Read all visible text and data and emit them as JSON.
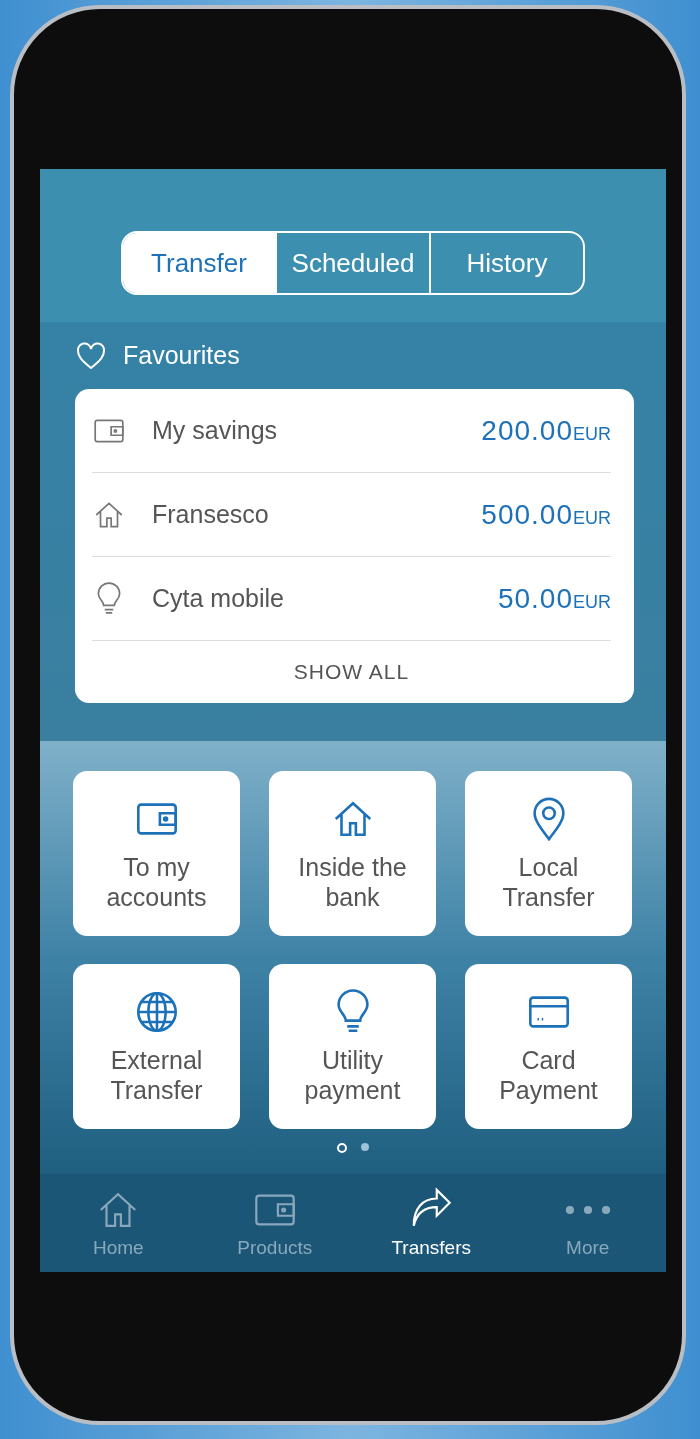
{
  "tabs": [
    {
      "label": "Transfer",
      "selected": true
    },
    {
      "label": "Scheduled",
      "selected": false
    },
    {
      "label": "History",
      "selected": false
    }
  ],
  "favourites": {
    "title": "Favourites",
    "items": [
      {
        "kind": "wallet",
        "name": "My savings",
        "amount": "200.00",
        "currency": "EUR"
      },
      {
        "kind": "house",
        "name": "Fransesco",
        "amount": "500.00",
        "currency": "EUR"
      },
      {
        "kind": "bulb",
        "name": "Cyta mobile",
        "amount": "50.00",
        "currency": "EUR"
      }
    ],
    "show_all": "SHOW ALL"
  },
  "actions": [
    {
      "kind": "wallet",
      "label": "To my accounts"
    },
    {
      "kind": "house",
      "label": "Inside the bank"
    },
    {
      "kind": "pin",
      "label": "Local Transfer"
    },
    {
      "kind": "globe",
      "label": "External Transfer"
    },
    {
      "kind": "bulb",
      "label": "Utility payment"
    },
    {
      "kind": "card",
      "label": "Card Payment"
    }
  ],
  "pager": [
    {
      "selected": true
    },
    {
      "selected": false
    }
  ],
  "nav": [
    {
      "kind": "house",
      "label": "Home",
      "selected": false
    },
    {
      "kind": "wallet",
      "label": "Products",
      "selected": false
    },
    {
      "kind": "share",
      "label": "Transfers",
      "selected": true
    },
    {
      "kind": "dots",
      "label": "More",
      "selected": false
    }
  ]
}
